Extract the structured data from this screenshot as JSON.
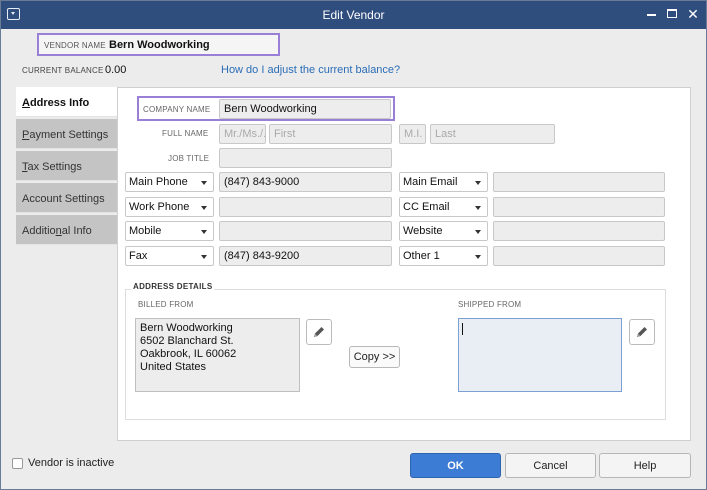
{
  "window": {
    "title": "Edit Vendor"
  },
  "vendor": {
    "label": "VENDOR NAME",
    "value": "Bern Woodworking"
  },
  "balance": {
    "label": "CURRENT BALANCE",
    "value": "0.00",
    "link": "How do I adjust the current balance?"
  },
  "tabs": [
    {
      "pre": "",
      "u": "A",
      "post": "ddress Info"
    },
    {
      "pre": "",
      "u": "P",
      "post": "ayment Settings"
    },
    {
      "pre": "",
      "u": "T",
      "post": "ax Settings"
    },
    {
      "pre": "Account Settin",
      "u": "g",
      "post": "s"
    },
    {
      "pre": "Additio",
      "u": "n",
      "post": "al Info"
    }
  ],
  "form": {
    "company_label": "COMPANY NAME",
    "company_value": "Bern Woodworking",
    "fullname_label": "FULL NAME",
    "salutation_ph": "Mr./Ms./...",
    "first_ph": "First",
    "mi_ph": "M.I.",
    "last_ph": "Last",
    "jobtitle_label": "JOB TITLE"
  },
  "contacts": {
    "left": [
      {
        "type": "Main Phone",
        "value": "(847) 843-9000"
      },
      {
        "type": "Work Phone",
        "value": ""
      },
      {
        "type": "Mobile",
        "value": ""
      },
      {
        "type": "Fax",
        "value": "(847) 843-9200"
      }
    ],
    "right": [
      {
        "type": "Main Email",
        "value": ""
      },
      {
        "type": "CC Email",
        "value": ""
      },
      {
        "type": "Website",
        "value": ""
      },
      {
        "type": "Other 1",
        "value": ""
      }
    ]
  },
  "address": {
    "section_label": "ADDRESS DETAILS",
    "billed_label": "BILLED FROM",
    "billed_value": "Bern Woodworking\n6502 Blanchard St.\nOakbrook, IL 60062\nUnited States",
    "shipped_label": "SHIPPED FROM",
    "shipped_value": "",
    "copy_label": "Copy >>"
  },
  "footer": {
    "inactive_label": "Vendor is inactive",
    "ok_label": "OK",
    "cancel_label": "Cancel",
    "help_label": "Help"
  },
  "icons": {
    "edit": "pencil-icon",
    "checkbox": "checkbox-unchecked"
  }
}
